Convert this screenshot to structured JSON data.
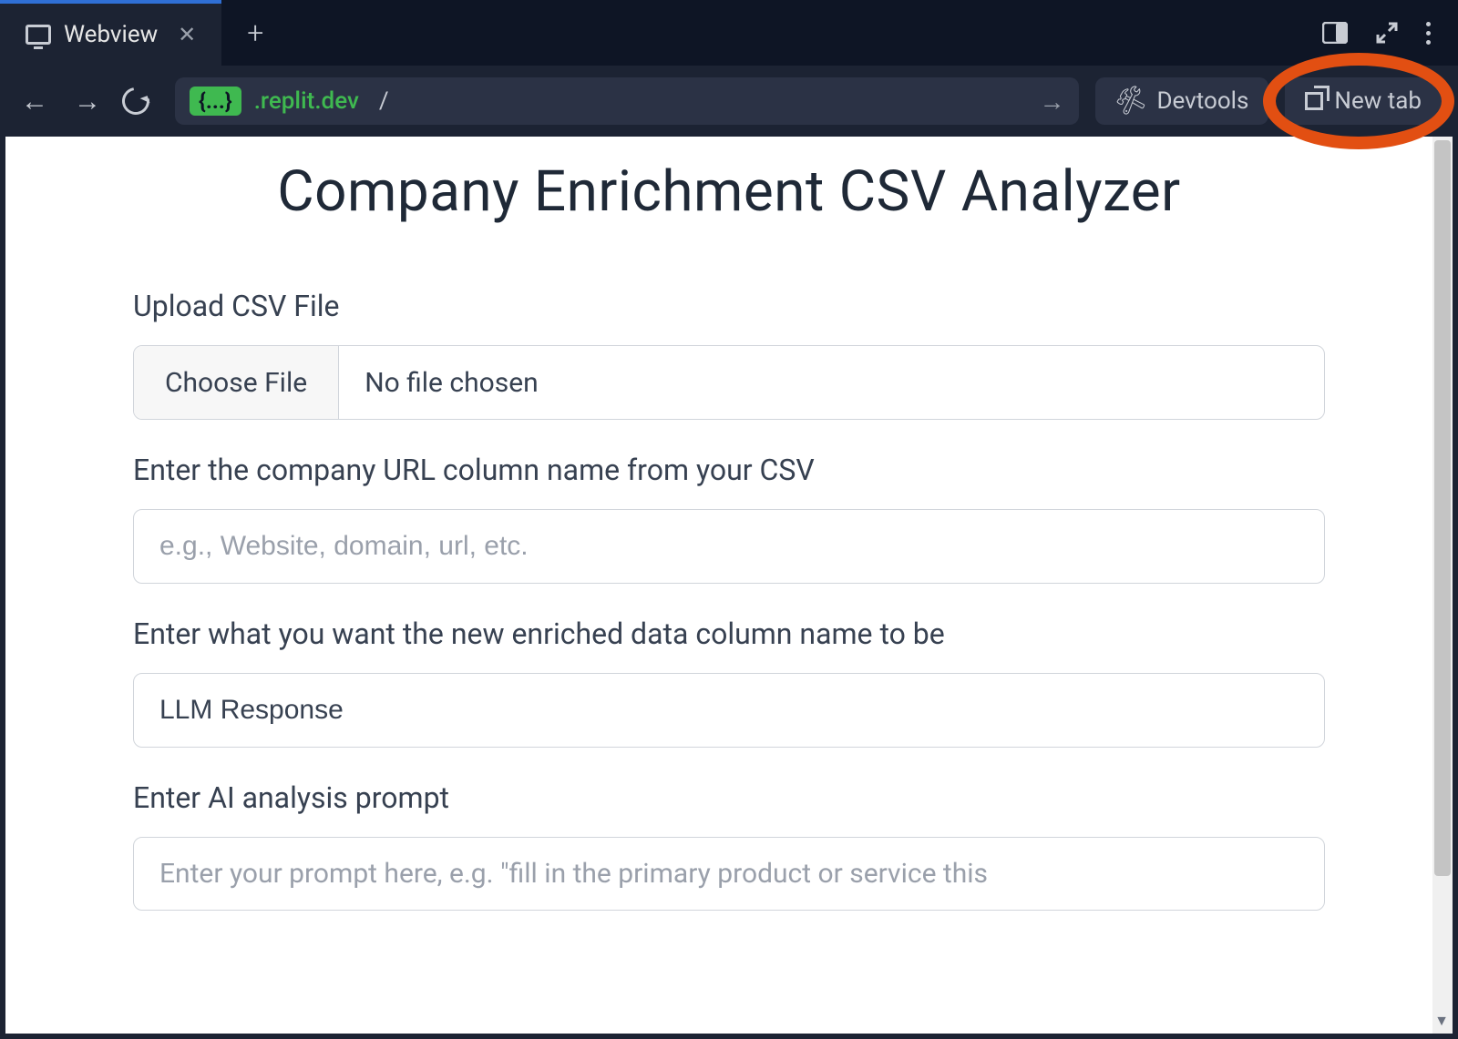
{
  "tabstrip": {
    "tab_label": "Webview"
  },
  "urlbar": {
    "chip": "{...}",
    "domain": ".replit.dev",
    "path": "/",
    "devtools_label": "Devtools",
    "newtab_label": "New tab"
  },
  "page": {
    "title": "Company Enrichment CSV Analyzer",
    "upload_label": "Upload CSV File",
    "choose_file_label": "Choose File",
    "file_status": "No file chosen",
    "url_column_label": "Enter the company URL column name from your CSV",
    "url_column_placeholder": "e.g., Website, domain, url, etc.",
    "url_column_value": "",
    "new_column_label": "Enter what you want the new enriched data column name to be",
    "new_column_value": "LLM Response",
    "prompt_label": "Enter AI analysis prompt",
    "prompt_placeholder": "Enter your prompt here, e.g. \"fill in the primary product or service this",
    "prompt_value": ""
  },
  "annotation": {
    "highlight_target": "new-tab-button",
    "color": "#e24f12"
  }
}
